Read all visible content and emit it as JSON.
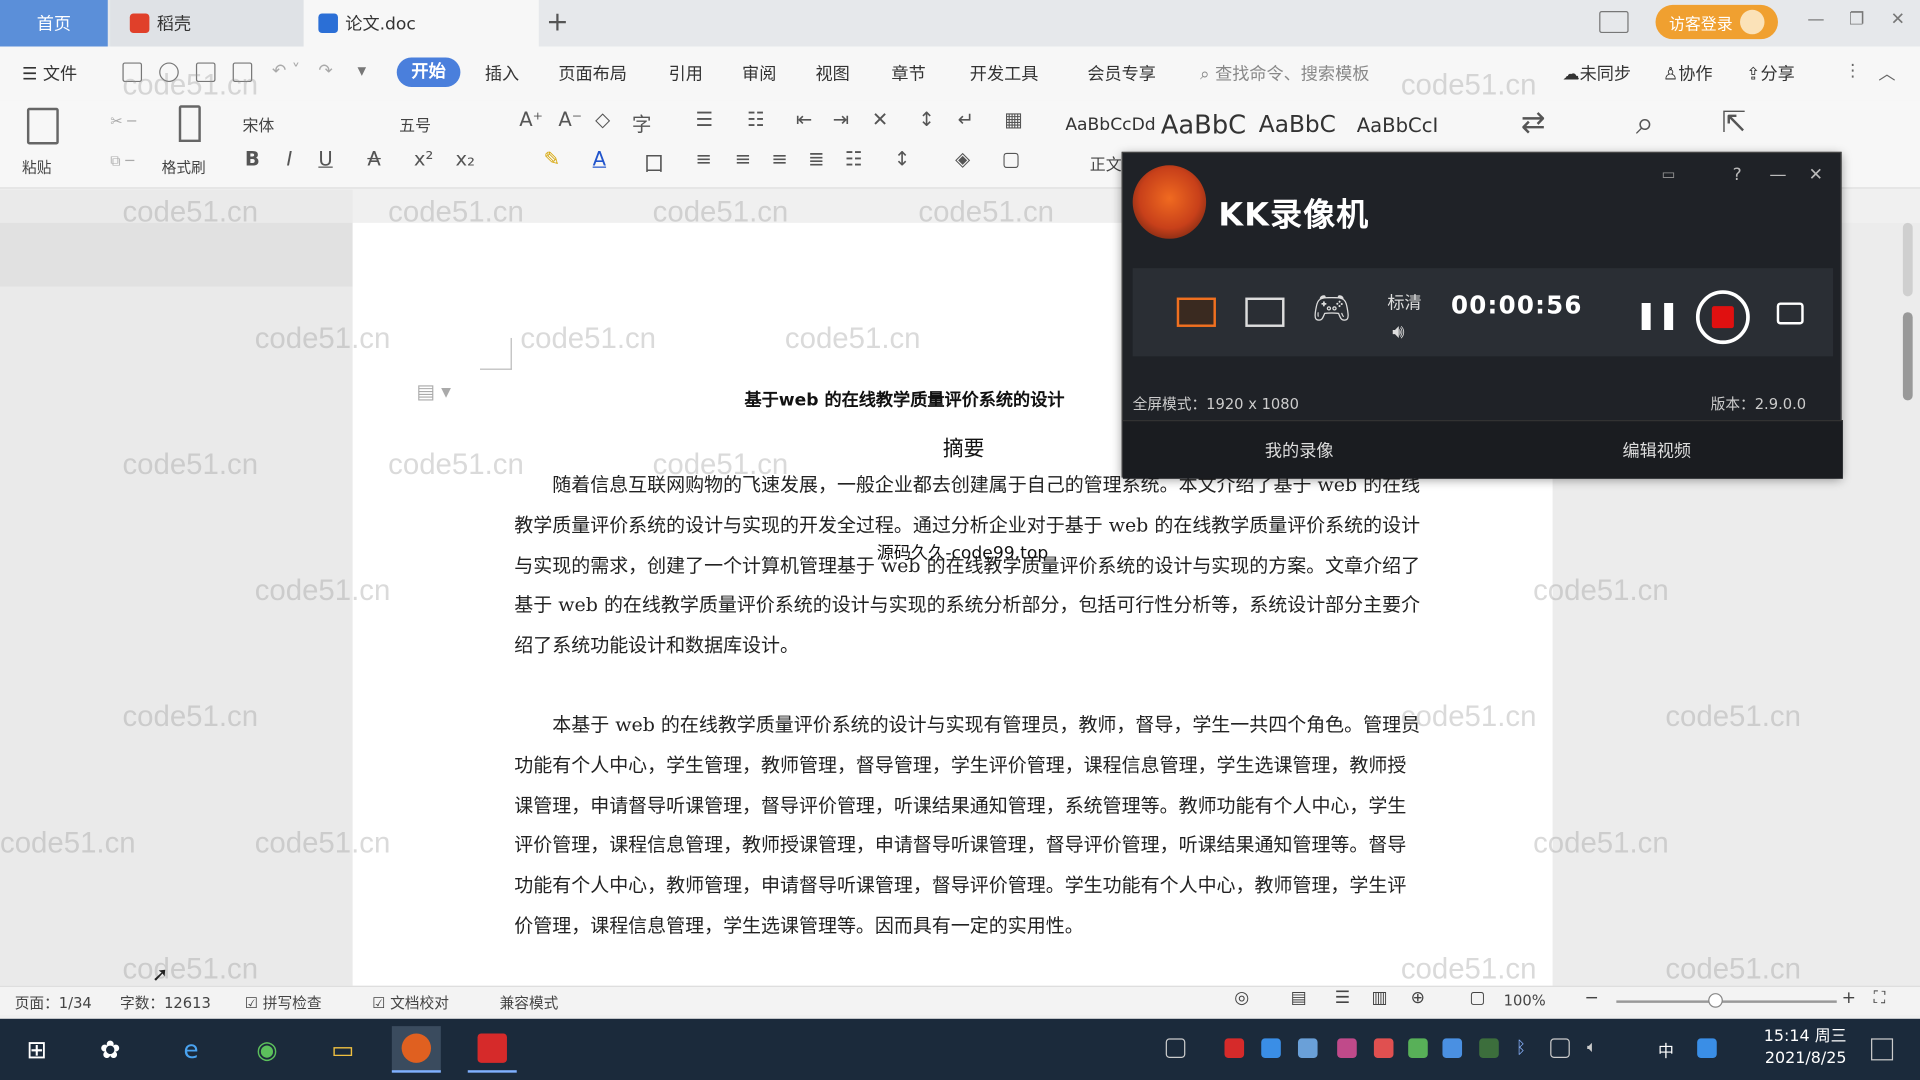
{
  "tabs": {
    "home": "首页",
    "docer": "稻壳",
    "doc": "论文.doc"
  },
  "header": {
    "visitor": "访客登录"
  },
  "menu": {
    "file": "文件",
    "start": "开始",
    "insert": "插入",
    "layout": "页面布局",
    "reference": "引用",
    "review": "审阅",
    "view": "视图",
    "chapter": "章节",
    "devtools": "开发工具",
    "member": "会员专享",
    "search": "查找命令、搜索模板",
    "unsync": "未同步",
    "collab": "协作",
    "share": "分享"
  },
  "ribbon": {
    "paste": "粘贴",
    "format_painter": "格式刷",
    "font": "宋体",
    "size": "五号",
    "styles": [
      "AaBbCcDd",
      "AaBbC",
      "AaBbC",
      "AaBbCcI"
    ],
    "style_normal": "正文"
  },
  "document": {
    "title": "基于web 的在线教学质量评价系统的设计",
    "heading": "摘要",
    "paragraphs": [
      "随着信息互联网购物的飞速发展，一般企业都去创建属于自己的管理系统。本文介绍了基于 web 的在线教学质量评价系统的设计与实现的开发全过程。通过分析企业对于基于 web 的在线教学质量评价系统的设计与实现的需求，创建了一个计算机管理基于 web 的在线教学质量评价系统的设计与实现的方案。文章介绍了基于 web 的在线教学质量评价系统的设计与实现的系统分析部分，包括可行性分析等，系统设计部分主要介绍了系统功能设计和数据库设计。",
      "本基于 web 的在线教学质量评价系统的设计与实现有管理员，教师，督导，学生一共四个角色。管理员功能有个人中心，学生管理，教师管理，督导管理，学生评价管理，课程信息管理，学生选课管理，教师授课管理，申请督导听课管理，督导评价管理，听课结果通知管理，系统管理等。教师功能有个人中心，学生评价管理，课程信息管理，教师授课管理，申请督导听课管理，督导评价管理，听课结果通知管理等。督导功能有个人中心，教师管理，申请督导听课管理，督导评价管理。学生功能有个人中心，教师管理，学生评价管理，课程信息管理，学生选课管理等。因而具有一定的实用性。"
    ],
    "overlay_text": "源码久久-code99.top",
    "watermark": "code51.cn"
  },
  "recorder": {
    "title": "KK录像机",
    "quality": "标清",
    "time": "00:00:56",
    "mode": "全屏模式：1920 x 1080",
    "version": "版本：2.9.0.0",
    "my_records": "我的录像",
    "edit_video": "编辑视频"
  },
  "status": {
    "page": "页面：1/34",
    "words": "字数：12613",
    "spell": "拼写检查",
    "doc_check": "文档校对",
    "compat": "兼容模式",
    "zoom": "100%"
  },
  "taskbar": {
    "time": "15:14 周三",
    "date": "2021/8/25",
    "ime": "中"
  }
}
